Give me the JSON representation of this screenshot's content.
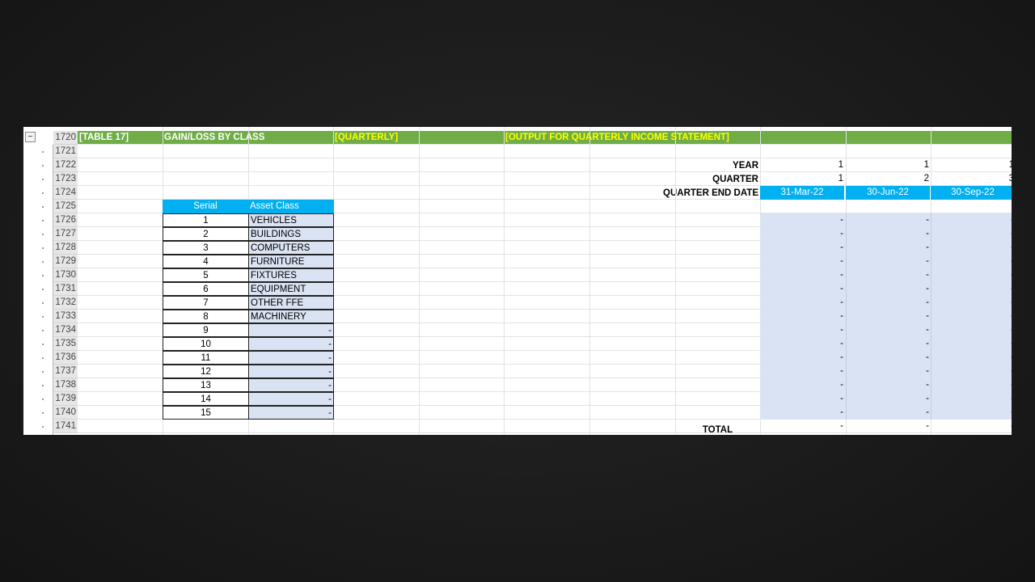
{
  "header": {
    "row": "1720",
    "table_id": "[TABLE 17]",
    "title": "GAIN/LOSS BY CLASS",
    "period": "[QUARTERLY]",
    "note": "[OUTPUT FOR QUARTERLY INCOME STATEMENT]"
  },
  "row_numbers": [
    "1720",
    "1721",
    "1722",
    "1723",
    "1724",
    "1725",
    "1726",
    "1727",
    "1728",
    "1729",
    "1730",
    "1731",
    "1732",
    "1733",
    "1734",
    "1735",
    "1736",
    "1737",
    "1738",
    "1739",
    "1740",
    "1741"
  ],
  "labels": {
    "year": "YEAR",
    "quarter": "QUARTER",
    "quarter_end_date": "QUARTER END DATE",
    "total": "TOTAL"
  },
  "columns": [
    {
      "year": "1",
      "quarter": "1",
      "date": "31-Mar-22",
      "total": "-"
    },
    {
      "year": "1",
      "quarter": "2",
      "date": "30-Jun-22",
      "total": "-"
    },
    {
      "year": "1",
      "quarter": "3",
      "date": "30-Sep-22",
      "total": "-"
    }
  ],
  "class_table": {
    "headers": [
      "Serial",
      "Asset Class"
    ],
    "rows": [
      {
        "serial": "1",
        "cls": "VEHICLES"
      },
      {
        "serial": "2",
        "cls": "BUILDINGS"
      },
      {
        "serial": "3",
        "cls": "COMPUTERS"
      },
      {
        "serial": "4",
        "cls": "FURNITURE"
      },
      {
        "serial": "5",
        "cls": "FIXTURES"
      },
      {
        "serial": "6",
        "cls": "EQUIPMENT"
      },
      {
        "serial": "7",
        "cls": "OTHER FFE"
      },
      {
        "serial": "8",
        "cls": "MACHINERY"
      },
      {
        "serial": "9",
        "cls": "-"
      },
      {
        "serial": "10",
        "cls": "-"
      },
      {
        "serial": "11",
        "cls": "-"
      },
      {
        "serial": "12",
        "cls": "-"
      },
      {
        "serial": "13",
        "cls": "-"
      },
      {
        "serial": "14",
        "cls": "-"
      },
      {
        "serial": "15",
        "cls": "-"
      }
    ]
  },
  "dash": "-",
  "outline": {
    "collapse_symbol": "−"
  },
  "colors": {
    "band": "#70ad47",
    "band_white": "#ffffff",
    "band_yellow": "#ffff00",
    "header_blue": "#00b0f0",
    "fill_lavender": "#dae3f3"
  }
}
